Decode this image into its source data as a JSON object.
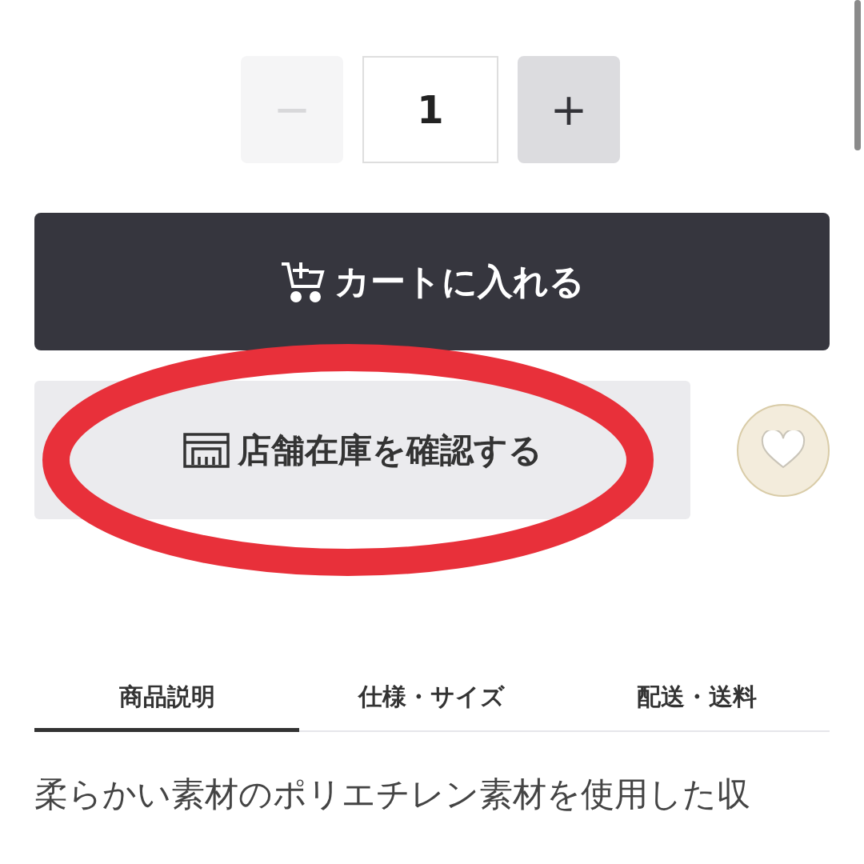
{
  "quantity": {
    "decrease": {
      "label": "−",
      "disabled": true
    },
    "value": "1",
    "increase": {
      "label": "+",
      "disabled": false
    }
  },
  "cart_button": {
    "label": "カートに入れる"
  },
  "store_stock_button": {
    "label": "店舗在庫を確認する"
  },
  "favorite": {
    "selected": false
  },
  "tabs": [
    {
      "label": "商品説明",
      "selected": true
    },
    {
      "label": "仕様・サイズ",
      "selected": false
    },
    {
      "label": "配送・送料",
      "selected": false
    }
  ],
  "description": "柔らかい素材のポリエチレン素材を使用した収"
}
